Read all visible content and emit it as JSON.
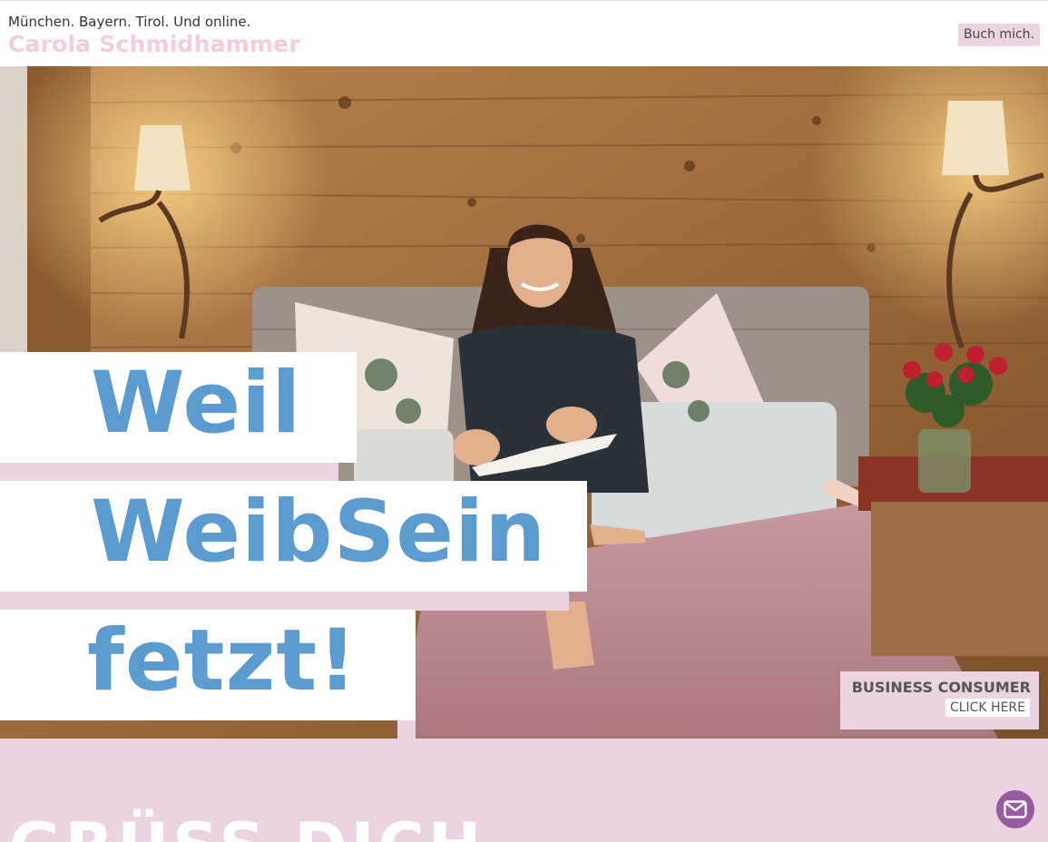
{
  "header": {
    "tagline": "München. Bayern. Tirol. Und online.",
    "brand": "Carola Schmidhammer",
    "book_button": "Buch mich."
  },
  "hero": {
    "headline_lines": [
      "Weil",
      "WeibSein",
      "fetzt!"
    ],
    "photo_subject": "woman-reading-on-bed"
  },
  "audience_box": {
    "title": "BUSINESS CONSUMER",
    "link": "CLICK HERE"
  },
  "section": {
    "heading": "GRÜSS DICH"
  },
  "contact": {
    "icon": "envelope-icon"
  },
  "colors": {
    "brand_pink": "#f2ccdf",
    "panel_pink": "#ebd3e2",
    "headline_blue": "#5b9bd0",
    "mail_purple": "#9a5aa0"
  }
}
